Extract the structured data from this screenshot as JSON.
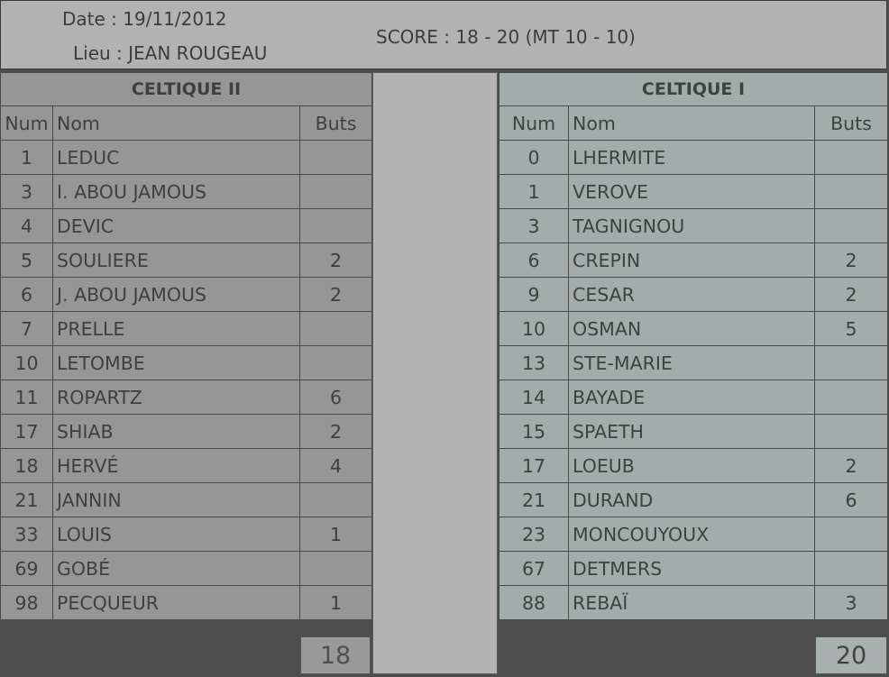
{
  "header": {
    "date": "Date : 19/11/2012",
    "lieu": "Lieu : JEAN ROUGEAU",
    "score": "SCORE : 18 - 20 (MT 10 - 10)"
  },
  "columns": {
    "num": "Num",
    "nom": "Nom",
    "buts": "Buts"
  },
  "team_left": {
    "name": "CELTIQUE II",
    "total": "18",
    "players": [
      {
        "num": "1",
        "nom": "LEDUC",
        "buts": ""
      },
      {
        "num": "3",
        "nom": "I. ABOU JAMOUS",
        "buts": ""
      },
      {
        "num": "4",
        "nom": "DEVIC",
        "buts": ""
      },
      {
        "num": "5",
        "nom": "SOULIERE",
        "buts": "2"
      },
      {
        "num": "6",
        "nom": "J. ABOU JAMOUS",
        "buts": "2"
      },
      {
        "num": "7",
        "nom": "PRELLE",
        "buts": ""
      },
      {
        "num": "10",
        "nom": "LETOMBE",
        "buts": ""
      },
      {
        "num": "11",
        "nom": "ROPARTZ",
        "buts": "6"
      },
      {
        "num": "17",
        "nom": "SHIAB",
        "buts": "2"
      },
      {
        "num": "18",
        "nom": "HERVÉ",
        "buts": "4"
      },
      {
        "num": "21",
        "nom": "JANNIN",
        "buts": ""
      },
      {
        "num": "33",
        "nom": "LOUIS",
        "buts": "1"
      },
      {
        "num": "69",
        "nom": "GOBÉ",
        "buts": ""
      },
      {
        "num": "98",
        "nom": "PECQUEUR",
        "buts": "1"
      }
    ]
  },
  "team_right": {
    "name": "CELTIQUE I",
    "total": "20",
    "players": [
      {
        "num": "0",
        "nom": "LHERMITE",
        "buts": ""
      },
      {
        "num": "1",
        "nom": "VEROVE",
        "buts": ""
      },
      {
        "num": "3",
        "nom": "TAGNIGNOU",
        "buts": ""
      },
      {
        "num": "6",
        "nom": "CREPIN",
        "buts": "2"
      },
      {
        "num": "9",
        "nom": "CESAR",
        "buts": "2"
      },
      {
        "num": "10",
        "nom": "OSMAN",
        "buts": "5"
      },
      {
        "num": "13",
        "nom": "STE-MARIE",
        "buts": ""
      },
      {
        "num": "14",
        "nom": "BAYADE",
        "buts": ""
      },
      {
        "num": "15",
        "nom": "SPAETH",
        "buts": ""
      },
      {
        "num": "17",
        "nom": "LOEUB",
        "buts": "2"
      },
      {
        "num": "21",
        "nom": "DURAND",
        "buts": "6"
      },
      {
        "num": "23",
        "nom": "MONCOUYOUX",
        "buts": ""
      },
      {
        "num": "67",
        "nom": "DETMERS",
        "buts": ""
      },
      {
        "num": "88",
        "nom": "REBAÏ",
        "buts": "3"
      }
    ]
  }
}
